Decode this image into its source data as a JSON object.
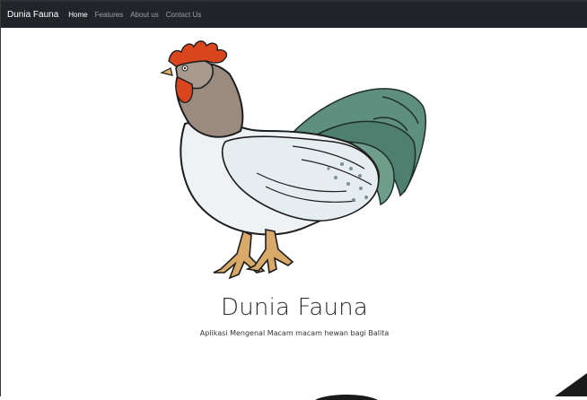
{
  "navbar": {
    "brand": "Dunia Fauna",
    "items": [
      {
        "label": "Home",
        "active": true
      },
      {
        "label": "Features",
        "active": false
      },
      {
        "label": "About us",
        "active": false
      },
      {
        "label": "Contact Us",
        "active": false
      }
    ]
  },
  "hero": {
    "image_icon": "rooster-illustration",
    "title": "Dunia Fauna",
    "subtitle": "Aplikasi Mengenal Macam macam hewan bagi Balita"
  },
  "colors": {
    "navbar_bg": "#212529",
    "comb": "#d9461e",
    "tail": "#4e7f6f"
  }
}
